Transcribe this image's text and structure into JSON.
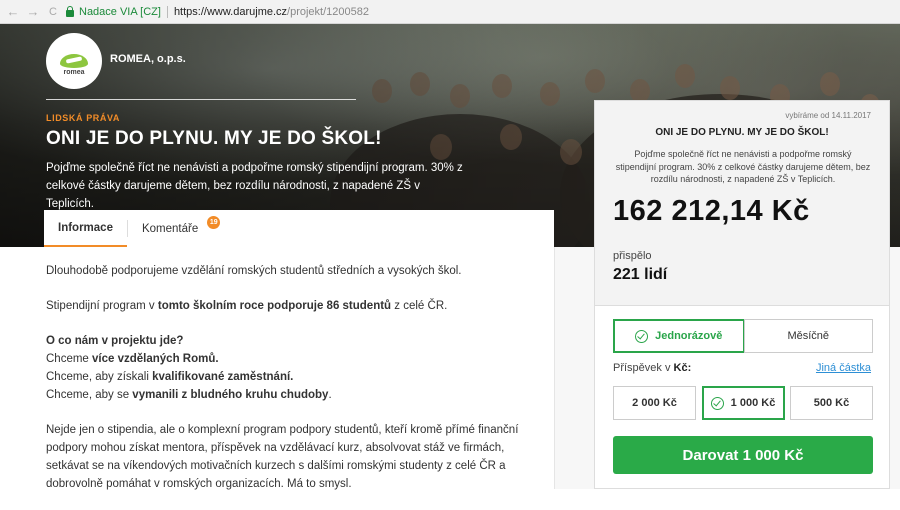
{
  "browser": {
    "secure_label": "Nadace VIA [CZ]",
    "url_main": "https://www.darujme.cz",
    "url_rest": "/projekt/1200582",
    "back": "←",
    "forward": "→",
    "reload": "C"
  },
  "org": {
    "name": "ROMEA, o.p.s.",
    "logo_text": "romea"
  },
  "hero": {
    "category": "LIDSKÁ PRÁVA",
    "title": "ONI JE DO PLYNU. MY JE DO ŠKOL!",
    "description": "Pojďme společně říct ne nenávisti a podpořme romský stipendijní program. 30% z celkové částky darujeme dětem, bez rozdílu národnosti, z napadené ZŠ v Teplicích."
  },
  "tabs": [
    {
      "label": "Informace"
    },
    {
      "label": "Komentáře",
      "badge": "19"
    }
  ],
  "article": {
    "p1": "Dlouhodobě podporujeme vzdělání romských studentů středních a vysokých škol.",
    "p2_a": "Stipendijní program v ",
    "p2_b": "tomto školním roce podporuje 86 studentů",
    "p2_c": " z celé ČR.",
    "q": "O co nám v projektu jde?",
    "l1_a": "Chceme ",
    "l1_b": "více vzdělaných Romů.",
    "l2_a": "Chceme, aby získali ",
    "l2_b": "kvalifikované zaměstnání.",
    "l3_a": "Chceme, aby se ",
    "l3_b": "vymanili z bludného kruhu chudoby",
    "l3_c": ".",
    "p4": "Nejde jen o stipendia, ale o komplexní program podpory studentů, kteří kromě přímé finanční podpory mohou získat mentora, příspěvek na vzdělávací kurz, absolvovat stáž ve firmách, setkávat se na víkendových motivačních kurzech s dalšími romskými studenty z celé ČR a dobrovolně pomáhat v romských organizacích. Má to smysl."
  },
  "card": {
    "deadline": "vybíráme od 14.11.2017",
    "title": "ONI JE DO PLYNU. MY JE DO ŠKOL!",
    "description": "Pojďme společně říct ne nenávisti a podpořme romský stipendijní program. 30% z celkové částky darujeme dětem, bez rozdílu národnosti, z napadené ZŠ v Teplicích.",
    "amount": "162 212,14 Kč",
    "contributed_label": "přispělo",
    "people": "221 lidí",
    "freq_once": "Jednorázově",
    "freq_monthly": "Měsíčně",
    "amount_label": "Příspěvek v",
    "currency": "Kč:",
    "custom_amount": "Jiná částka",
    "amounts": [
      "2 000 Kč",
      "1 000 Kč",
      "500 Kč"
    ],
    "donate": "Darovat 1 000 Kč"
  },
  "colors": {
    "accent": "#f28c28",
    "green": "#2aaa48",
    "link": "#2d8fd5"
  }
}
